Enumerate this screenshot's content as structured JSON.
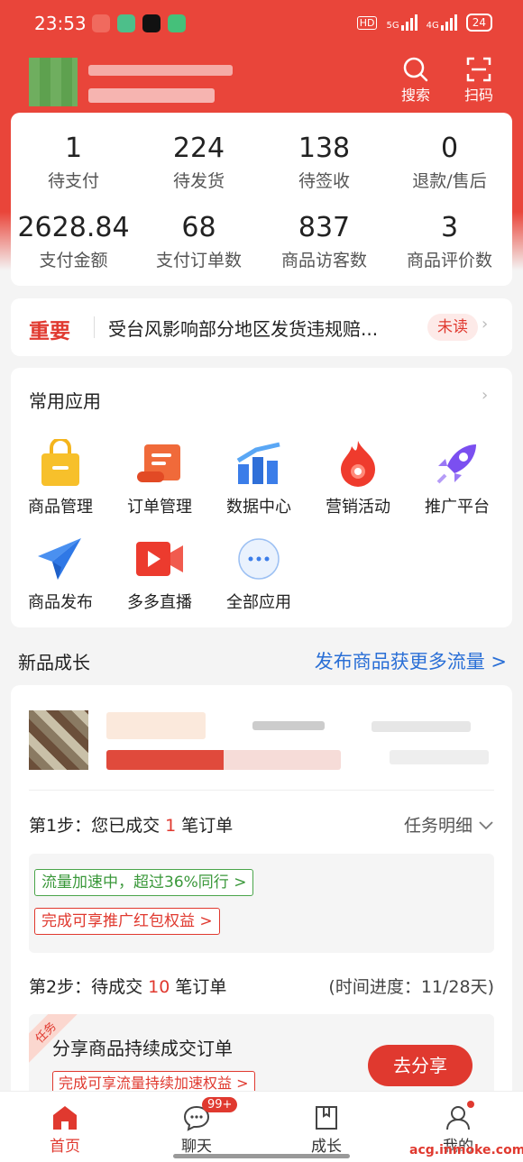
{
  "status_bar": {
    "time": "23:53",
    "hd": "HD",
    "net1": "5G",
    "net2": "4G",
    "battery": "24"
  },
  "header": {
    "search_label": "搜索",
    "scan_label": "扫码"
  },
  "stats": [
    {
      "value": "1",
      "label": "待支付"
    },
    {
      "value": "224",
      "label": "待发货"
    },
    {
      "value": "138",
      "label": "待签收"
    },
    {
      "value": "0",
      "label": "退款/售后"
    },
    {
      "value": "2628.84",
      "label": "支付金额"
    },
    {
      "value": "68",
      "label": "支付订单数"
    },
    {
      "value": "837",
      "label": "商品访客数"
    },
    {
      "value": "3",
      "label": "商品评价数"
    }
  ],
  "notice": {
    "tag": "重要",
    "text": "受台风影响部分地区发货违规赔...",
    "status": "未读"
  },
  "common_apps": {
    "title": "常用应用",
    "items": [
      {
        "label": "商品管理",
        "icon": "shopping-bag-icon"
      },
      {
        "label": "订单管理",
        "icon": "order-scroll-icon"
      },
      {
        "label": "数据中心",
        "icon": "data-chart-icon"
      },
      {
        "label": "营销活动",
        "icon": "flame-icon"
      },
      {
        "label": "推广平台",
        "icon": "rocket-icon"
      },
      {
        "label": "商品发布",
        "icon": "paper-plane-icon"
      },
      {
        "label": "多多直播",
        "icon": "live-video-icon"
      },
      {
        "label": "全部应用",
        "icon": "more-dots-icon"
      }
    ]
  },
  "new_growth": {
    "title": "新品成长",
    "link": "发布商品获更多流量 >",
    "step1": {
      "prefix": "第1步：您已成交 ",
      "count": "1",
      "suffix": " 笔订单",
      "detail": "任务明细"
    },
    "pill_green": "流量加速中，超过36%同行 >",
    "pill_red": "完成可享推广红包权益 >",
    "step2": {
      "prefix": "第2步：待成交 ",
      "count": "10",
      "suffix": " 笔订单",
      "progress": "(时间进度：11/28天)"
    },
    "task": {
      "ribbon": "任务",
      "title": "分享商品持续成交订单",
      "pill": "完成可享流量持续加速权益 >",
      "button": "去分享"
    }
  },
  "tabbar": {
    "home": "首页",
    "chat": "聊天",
    "chat_badge": "99+",
    "growth": "成长",
    "mine": "我的"
  },
  "watermark": "acg.inmoke.com",
  "colors": {
    "brand_red": "#e9453a",
    "accent_red": "#e0392f",
    "link_blue": "#2a6fd6",
    "success_green": "#3a983a"
  }
}
